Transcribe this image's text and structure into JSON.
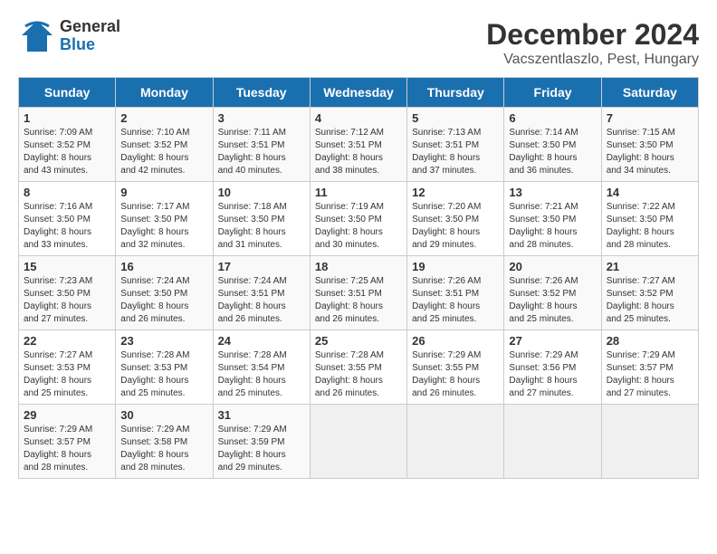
{
  "header": {
    "logo_general": "General",
    "logo_blue": "Blue",
    "title": "December 2024",
    "subtitle": "Vacszentlaszlo, Pest, Hungary"
  },
  "calendar": {
    "days_of_week": [
      "Sunday",
      "Monday",
      "Tuesday",
      "Wednesday",
      "Thursday",
      "Friday",
      "Saturday"
    ],
    "weeks": [
      [
        {
          "day": "1",
          "lines": [
            "Sunrise: 7:09 AM",
            "Sunset: 3:52 PM",
            "Daylight: 8 hours",
            "and 43 minutes."
          ]
        },
        {
          "day": "2",
          "lines": [
            "Sunrise: 7:10 AM",
            "Sunset: 3:52 PM",
            "Daylight: 8 hours",
            "and 42 minutes."
          ]
        },
        {
          "day": "3",
          "lines": [
            "Sunrise: 7:11 AM",
            "Sunset: 3:51 PM",
            "Daylight: 8 hours",
            "and 40 minutes."
          ]
        },
        {
          "day": "4",
          "lines": [
            "Sunrise: 7:12 AM",
            "Sunset: 3:51 PM",
            "Daylight: 8 hours",
            "and 38 minutes."
          ]
        },
        {
          "day": "5",
          "lines": [
            "Sunrise: 7:13 AM",
            "Sunset: 3:51 PM",
            "Daylight: 8 hours",
            "and 37 minutes."
          ]
        },
        {
          "day": "6",
          "lines": [
            "Sunrise: 7:14 AM",
            "Sunset: 3:50 PM",
            "Daylight: 8 hours",
            "and 36 minutes."
          ]
        },
        {
          "day": "7",
          "lines": [
            "Sunrise: 7:15 AM",
            "Sunset: 3:50 PM",
            "Daylight: 8 hours",
            "and 34 minutes."
          ]
        }
      ],
      [
        {
          "day": "8",
          "lines": [
            "Sunrise: 7:16 AM",
            "Sunset: 3:50 PM",
            "Daylight: 8 hours",
            "and 33 minutes."
          ]
        },
        {
          "day": "9",
          "lines": [
            "Sunrise: 7:17 AM",
            "Sunset: 3:50 PM",
            "Daylight: 8 hours",
            "and 32 minutes."
          ]
        },
        {
          "day": "10",
          "lines": [
            "Sunrise: 7:18 AM",
            "Sunset: 3:50 PM",
            "Daylight: 8 hours",
            "and 31 minutes."
          ]
        },
        {
          "day": "11",
          "lines": [
            "Sunrise: 7:19 AM",
            "Sunset: 3:50 PM",
            "Daylight: 8 hours",
            "and 30 minutes."
          ]
        },
        {
          "day": "12",
          "lines": [
            "Sunrise: 7:20 AM",
            "Sunset: 3:50 PM",
            "Daylight: 8 hours",
            "and 29 minutes."
          ]
        },
        {
          "day": "13",
          "lines": [
            "Sunrise: 7:21 AM",
            "Sunset: 3:50 PM",
            "Daylight: 8 hours",
            "and 28 minutes."
          ]
        },
        {
          "day": "14",
          "lines": [
            "Sunrise: 7:22 AM",
            "Sunset: 3:50 PM",
            "Daylight: 8 hours",
            "and 28 minutes."
          ]
        }
      ],
      [
        {
          "day": "15",
          "lines": [
            "Sunrise: 7:23 AM",
            "Sunset: 3:50 PM",
            "Daylight: 8 hours",
            "and 27 minutes."
          ]
        },
        {
          "day": "16",
          "lines": [
            "Sunrise: 7:24 AM",
            "Sunset: 3:50 PM",
            "Daylight: 8 hours",
            "and 26 minutes."
          ]
        },
        {
          "day": "17",
          "lines": [
            "Sunrise: 7:24 AM",
            "Sunset: 3:51 PM",
            "Daylight: 8 hours",
            "and 26 minutes."
          ]
        },
        {
          "day": "18",
          "lines": [
            "Sunrise: 7:25 AM",
            "Sunset: 3:51 PM",
            "Daylight: 8 hours",
            "and 26 minutes."
          ]
        },
        {
          "day": "19",
          "lines": [
            "Sunrise: 7:26 AM",
            "Sunset: 3:51 PM",
            "Daylight: 8 hours",
            "and 25 minutes."
          ]
        },
        {
          "day": "20",
          "lines": [
            "Sunrise: 7:26 AM",
            "Sunset: 3:52 PM",
            "Daylight: 8 hours",
            "and 25 minutes."
          ]
        },
        {
          "day": "21",
          "lines": [
            "Sunrise: 7:27 AM",
            "Sunset: 3:52 PM",
            "Daylight: 8 hours",
            "and 25 minutes."
          ]
        }
      ],
      [
        {
          "day": "22",
          "lines": [
            "Sunrise: 7:27 AM",
            "Sunset: 3:53 PM",
            "Daylight: 8 hours",
            "and 25 minutes."
          ]
        },
        {
          "day": "23",
          "lines": [
            "Sunrise: 7:28 AM",
            "Sunset: 3:53 PM",
            "Daylight: 8 hours",
            "and 25 minutes."
          ]
        },
        {
          "day": "24",
          "lines": [
            "Sunrise: 7:28 AM",
            "Sunset: 3:54 PM",
            "Daylight: 8 hours",
            "and 25 minutes."
          ]
        },
        {
          "day": "25",
          "lines": [
            "Sunrise: 7:28 AM",
            "Sunset: 3:55 PM",
            "Daylight: 8 hours",
            "and 26 minutes."
          ]
        },
        {
          "day": "26",
          "lines": [
            "Sunrise: 7:29 AM",
            "Sunset: 3:55 PM",
            "Daylight: 8 hours",
            "and 26 minutes."
          ]
        },
        {
          "day": "27",
          "lines": [
            "Sunrise: 7:29 AM",
            "Sunset: 3:56 PM",
            "Daylight: 8 hours",
            "and 27 minutes."
          ]
        },
        {
          "day": "28",
          "lines": [
            "Sunrise: 7:29 AM",
            "Sunset: 3:57 PM",
            "Daylight: 8 hours",
            "and 27 minutes."
          ]
        }
      ],
      [
        {
          "day": "29",
          "lines": [
            "Sunrise: 7:29 AM",
            "Sunset: 3:57 PM",
            "Daylight: 8 hours",
            "and 28 minutes."
          ]
        },
        {
          "day": "30",
          "lines": [
            "Sunrise: 7:29 AM",
            "Sunset: 3:58 PM",
            "Daylight: 8 hours",
            "and 28 minutes."
          ]
        },
        {
          "day": "31",
          "lines": [
            "Sunrise: 7:29 AM",
            "Sunset: 3:59 PM",
            "Daylight: 8 hours",
            "and 29 minutes."
          ]
        },
        {
          "day": "",
          "lines": []
        },
        {
          "day": "",
          "lines": []
        },
        {
          "day": "",
          "lines": []
        },
        {
          "day": "",
          "lines": []
        }
      ]
    ]
  }
}
